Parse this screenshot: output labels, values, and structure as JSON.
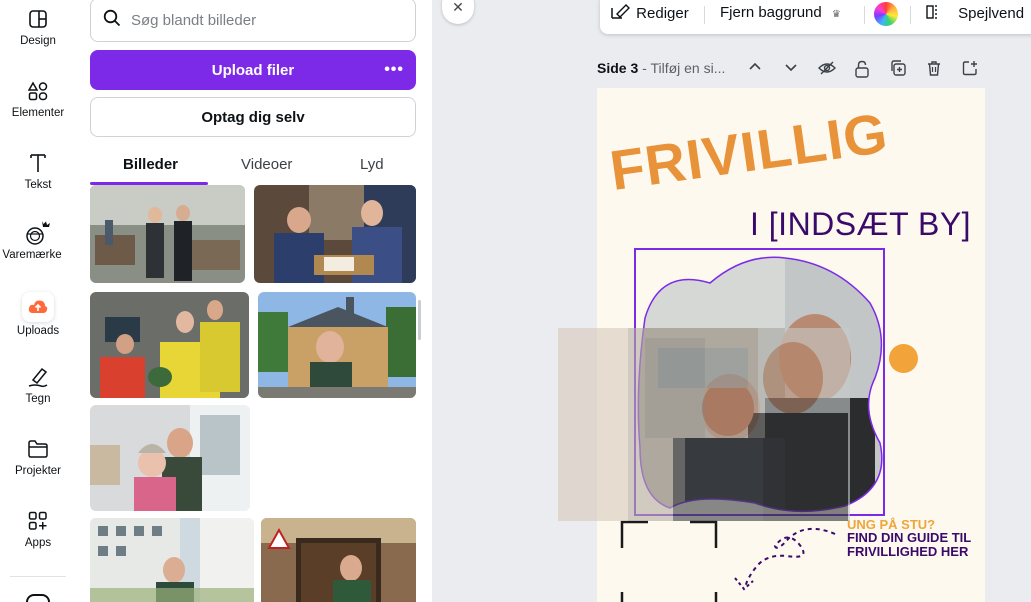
{
  "rail": {
    "items": [
      {
        "label": "Design",
        "icon": "design-icon"
      },
      {
        "label": "Elementer",
        "icon": "elements-icon"
      },
      {
        "label": "Tekst",
        "icon": "text-icon"
      },
      {
        "label": "Varemærke",
        "icon": "brand-icon"
      },
      {
        "label": "Uploads",
        "icon": "uploads-icon"
      },
      {
        "label": "Tegn",
        "icon": "draw-icon"
      },
      {
        "label": "Projekter",
        "icon": "folder-icon"
      },
      {
        "label": "Apps",
        "icon": "apps-icon"
      }
    ]
  },
  "panel": {
    "search_placeholder": "Søg blandt billeder",
    "upload_label": "Upload filer",
    "upload_more": "•••",
    "record_label": "Optag dig selv",
    "tabs": [
      {
        "label": "Billeder"
      },
      {
        "label": "Videoer"
      },
      {
        "label": "Lyd"
      }
    ],
    "active_tab": "Billeder"
  },
  "toolbar": {
    "edit_label": "Rediger",
    "remove_bg_label": "Fjern baggrund",
    "flip_label": "Spejlvend"
  },
  "page": {
    "number": "Side 3",
    "title_placeholder": " - Tilføj en si...",
    "heading": "FRIVILLIG",
    "subheading": "I [INDSÆT BY]",
    "tagline": "UNG PÅ STU?",
    "callout": "FIND DIN GUIDE TIL FRIVILLIGHED HER"
  },
  "colors": {
    "accent": "#7d2ae8",
    "orange": "#e8923a",
    "purple_text": "#3a0a6b",
    "page_bg": "#fdf9ef"
  }
}
